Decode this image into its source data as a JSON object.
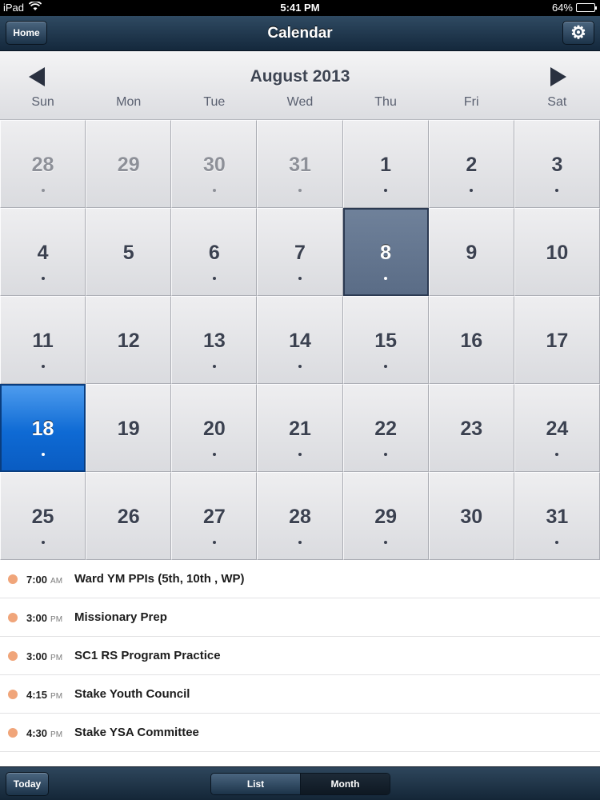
{
  "status_bar": {
    "device": "iPad",
    "time": "5:41 PM",
    "battery": "64%",
    "battery_level": 0.64
  },
  "nav": {
    "title": "Calendar",
    "home_label": "Home",
    "settings_icon": "gear-icon"
  },
  "calendar": {
    "month_label": "August 2013",
    "weekdays": [
      "Sun",
      "Mon",
      "Tue",
      "Wed",
      "Thu",
      "Fri",
      "Sat"
    ],
    "days": [
      {
        "n": "28",
        "other": true,
        "dot": true
      },
      {
        "n": "29",
        "other": true,
        "dot": false
      },
      {
        "n": "30",
        "other": true,
        "dot": true
      },
      {
        "n": "31",
        "other": true,
        "dot": true
      },
      {
        "n": "1",
        "dot": true
      },
      {
        "n": "2",
        "dot": true
      },
      {
        "n": "3",
        "dot": true
      },
      {
        "n": "4",
        "dot": true
      },
      {
        "n": "5",
        "dot": false
      },
      {
        "n": "6",
        "dot": true
      },
      {
        "n": "7",
        "dot": true
      },
      {
        "n": "8",
        "dot": true,
        "selected": true
      },
      {
        "n": "9",
        "dot": false
      },
      {
        "n": "10",
        "dot": false
      },
      {
        "n": "11",
        "dot": true
      },
      {
        "n": "12",
        "dot": false
      },
      {
        "n": "13",
        "dot": true
      },
      {
        "n": "14",
        "dot": true
      },
      {
        "n": "15",
        "dot": true
      },
      {
        "n": "16",
        "dot": false
      },
      {
        "n": "17",
        "dot": false
      },
      {
        "n": "18",
        "dot": true,
        "today": true
      },
      {
        "n": "19",
        "dot": false
      },
      {
        "n": "20",
        "dot": true
      },
      {
        "n": "21",
        "dot": true
      },
      {
        "n": "22",
        "dot": true
      },
      {
        "n": "23",
        "dot": false
      },
      {
        "n": "24",
        "dot": true
      },
      {
        "n": "25",
        "dot": true
      },
      {
        "n": "26",
        "dot": false
      },
      {
        "n": "27",
        "dot": true
      },
      {
        "n": "28",
        "dot": true
      },
      {
        "n": "29",
        "dot": true
      },
      {
        "n": "30",
        "dot": false
      },
      {
        "n": "31",
        "dot": true
      }
    ]
  },
  "events": [
    {
      "time": "7:00",
      "ampm": "AM",
      "title": "Ward YM PPIs (5th, 10th , WP)"
    },
    {
      "time": "3:00",
      "ampm": "PM",
      "title": "Missionary Prep"
    },
    {
      "time": "3:00",
      "ampm": "PM",
      "title": "SC1 RS Program Practice"
    },
    {
      "time": "4:15",
      "ampm": "PM",
      "title": "Stake Youth Council"
    },
    {
      "time": "4:30",
      "ampm": "PM",
      "title": "Stake YSA Committee"
    }
  ],
  "toolbar": {
    "today_label": "Today",
    "list_label": "List",
    "month_label": "Month"
  },
  "colors": {
    "accent_blue": "#0e6ad4",
    "selected": "#5a6c86",
    "event_bullet": "#f0a57a",
    "nav_bar": "#1c3349"
  }
}
